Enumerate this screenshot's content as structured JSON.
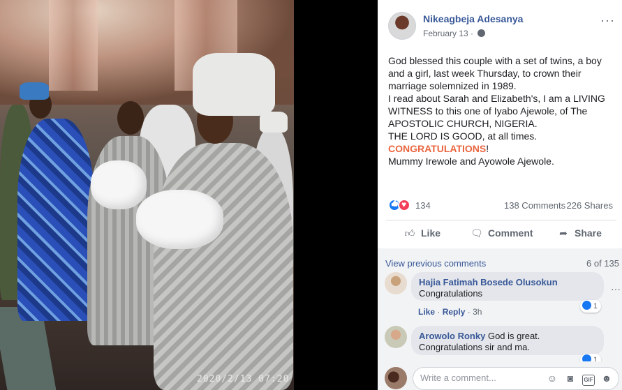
{
  "photo": {
    "timestamp": "2020/2/13  07:20"
  },
  "post": {
    "author": "Nikeagbeja Adesanya",
    "date": "February 13 · ",
    "more_label": "···",
    "text_lines": [
      "God blessed this couple with a set of twins, a boy",
      "and a girl, last week Thursday, to crown their",
      "marriage solemnized in 1989.",
      "I read about Sarah and Elizabeth's, I am a LIVING",
      "WITNESS to this one of Iyabo Ajewole, of The",
      "APOSTOLIC CHURCH, NIGERIA.",
      "THE LORD IS GOOD, at all times."
    ],
    "congrats": "CONGRATULATIONS",
    "congrats_suffix": "!",
    "signature": "Mummy Irewole and Ayowole Ajewole.",
    "reaction_count": "134",
    "comments_count": "138 Comments",
    "shares_count": "226 Shares"
  },
  "actions": {
    "like": "Like",
    "comment": "Comment",
    "share": "Share"
  },
  "comments_section": {
    "view_previous": "View previous comments",
    "count": "6 of 135",
    "comments": [
      {
        "name": "Hajia Fatimah Bosede Olusokun",
        "text": "Congratulations",
        "like_action": "Like",
        "reply_action": "Reply",
        "time": "3h",
        "likes": "1"
      },
      {
        "name": "Arowolo Ronky",
        "text_first": "God is great.",
        "text_second": "Congratulations sir and ma.",
        "likes": "1"
      }
    ],
    "write_placeholder": "Write a comment...",
    "gif_label": "GIF"
  },
  "colors": {
    "link": "#385898",
    "congrats": "#e9653f",
    "like_blue": "#1877f2",
    "love_red": "#f33e58"
  },
  "icons": [
    "globe-icon",
    "thumbs-up-icon",
    "comment-icon",
    "share-icon",
    "emoji-icon",
    "camera-icon",
    "gif-icon",
    "sticker-icon"
  ]
}
